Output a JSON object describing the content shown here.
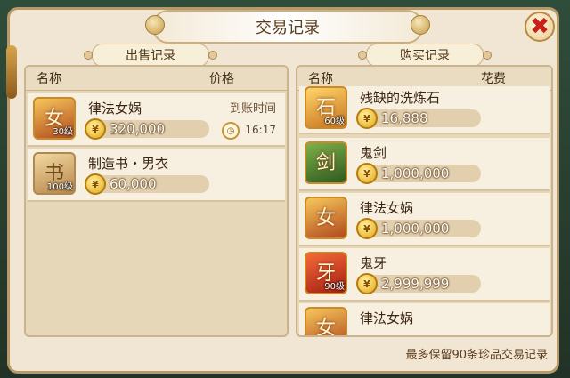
{
  "dialog": {
    "title": "交易记录",
    "close_symbol": "✖",
    "footer_note": "最多保留90条珍品交易记录"
  },
  "sell": {
    "section_title": "出售记录",
    "header_name": "名称",
    "header_price": "价格",
    "items": [
      {
        "name": "律法女娲",
        "level": "30级",
        "price": "320,000",
        "due_label": "到账时间",
        "due_time": "16:17",
        "glyph": "女"
      },
      {
        "name": "制造书・男衣",
        "level": "100级",
        "price": "60,000",
        "glyph": "书"
      }
    ]
  },
  "buy": {
    "section_title": "购买记录",
    "header_name": "名称",
    "header_cost": "花费",
    "items": [
      {
        "name": "残缺的洗炼石",
        "level": "60级",
        "price": "16,888",
        "glyph": "石"
      },
      {
        "name": "鬼剑",
        "level": "",
        "price": "1,000,000",
        "glyph": "剑"
      },
      {
        "name": "律法女娲",
        "level": "",
        "price": "1,000,000",
        "glyph": "女"
      },
      {
        "name": "鬼牙",
        "level": "90级",
        "price": "2,999,999",
        "glyph": "牙"
      },
      {
        "name": "律法女娲",
        "level": "",
        "price": "",
        "glyph": "女"
      }
    ]
  },
  "icons": {
    "coin": "coin-icon",
    "clock": "clock-icon",
    "close": "close-icon"
  },
  "colors": {
    "accent_red": "#c8201a",
    "panel": "#f1e6d3",
    "border": "#b89a6a"
  }
}
